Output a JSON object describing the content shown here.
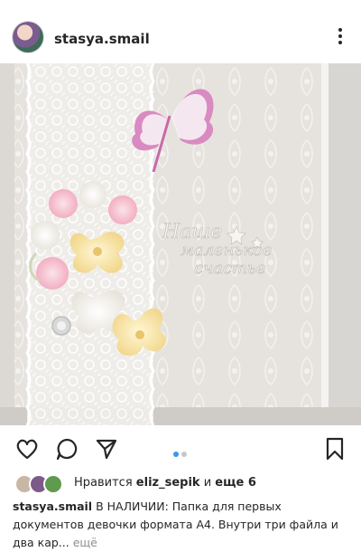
{
  "post": {
    "username": "stasya.smail",
    "more_menu_icon": "more-vertical-icon"
  },
  "photo": {
    "alt_subject": "Handmade document folder with lace, paper flowers and butterfly",
    "chipboard_text_line1": "Наше",
    "chipboard_text_line2": "маленькое",
    "chipboard_text_line3": "счастье"
  },
  "actions": {
    "like_icon": "heart-icon",
    "comment_icon": "comment-icon",
    "share_icon": "send-icon",
    "save_icon": "bookmark-icon",
    "carousel": {
      "total": 2,
      "active": 1
    }
  },
  "likes": {
    "prefix": "Нравится",
    "user": "eliz_sepik",
    "connector": "и",
    "others": "еще 6"
  },
  "caption": {
    "username": "stasya.smail",
    "text": " В НАЛИЧИИ: Папка для первых документов девочки формата А4. Внутри три файла и два кар...",
    "more": " ещё"
  },
  "colors": {
    "accent_blue": "#3897f0",
    "muted_dot": "#c7c7c7",
    "text": "#262626",
    "muted_text": "#8e8e8e"
  }
}
